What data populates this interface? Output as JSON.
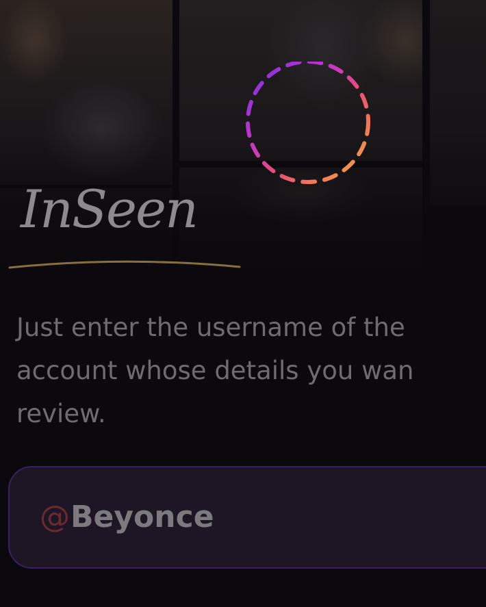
{
  "app": {
    "logo_text": "InSeen"
  },
  "hero": {
    "loading_indicator": "dashed-ring-spinner"
  },
  "description": {
    "lines": [
      "Just enter the username of the",
      "account whose details you wan",
      "review."
    ]
  },
  "search": {
    "prefix": "@",
    "value": "Beyonce"
  },
  "colors": {
    "background": "#0b090d",
    "ring_purple": "#8a2be2",
    "ring_pink": "#e0457b",
    "ring_orange": "#f5a623",
    "input_background": "#1e1624",
    "input_border": "#3a1f62",
    "logo_underline": "#a88a4a"
  }
}
